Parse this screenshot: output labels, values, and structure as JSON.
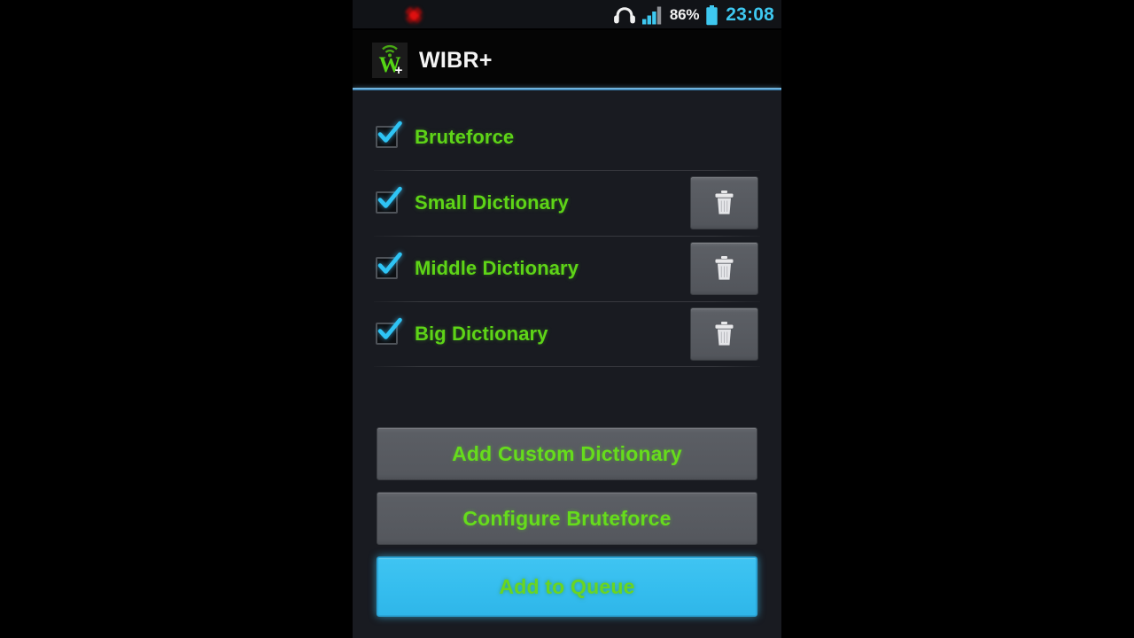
{
  "status_bar": {
    "notification_icon": "red-dot-notification-icon",
    "headphones_icon": "headphones-icon",
    "signal_icon": "signal-bars-icon",
    "battery_percent": "86%",
    "battery_icon": "battery-icon",
    "clock": "23:08"
  },
  "app_bar": {
    "icon": "wibr-plus-app-icon",
    "title": "WIBR+",
    "accent_color": "#6fb6dd"
  },
  "colors": {
    "label_green": "#5ed417",
    "active_blue": "#35bdee",
    "button_grey": "#5a5d63",
    "background": "#191b21"
  },
  "list": {
    "rows": [
      {
        "label": "Bruteforce",
        "checked": true,
        "has_delete": false,
        "delete_icon": "trash-icon"
      },
      {
        "label": "Small Dictionary",
        "checked": true,
        "has_delete": true,
        "delete_icon": "trash-icon"
      },
      {
        "label": "Middle Dictionary",
        "checked": true,
        "has_delete": true,
        "delete_icon": "trash-icon"
      },
      {
        "label": "Big Dictionary",
        "checked": true,
        "has_delete": true,
        "delete_icon": "trash-icon"
      }
    ]
  },
  "actions": {
    "add_custom_dictionary": "Add Custom Dictionary",
    "configure_bruteforce": "Configure Bruteforce",
    "add_to_queue": "Add to Queue"
  }
}
